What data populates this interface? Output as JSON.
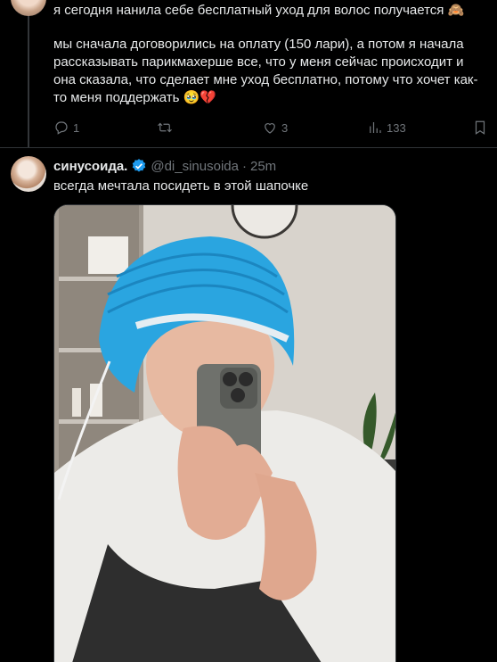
{
  "tweet1": {
    "line1": "я сегодня нанила себе бесплатный уход для волос получается 🙈",
    "body": "мы сначала договорились на оплату (150 лари), а потом я начала рассказывать парикмахерше все, что у меня сейчас происходит и она сказала, что сделает мне уход бесплатно, потому что хочет как-то меня поддержать 🥹💔",
    "replies": "1",
    "likes": "3",
    "views": "133"
  },
  "tweet2": {
    "name": "синусоида.",
    "handle": "@di_sinusoida",
    "dot": "·",
    "time": "25m",
    "text": "всегда мечтала посидеть в этой шапочке"
  },
  "colors": {
    "background": "#000000",
    "text": "#e7e9ea",
    "muted": "#71767b",
    "verified": "#1d9bf0",
    "cap": "#2aa5e0"
  },
  "icons": [
    "reply-icon",
    "retweet-icon",
    "like-icon",
    "views-icon",
    "bookmark-icon",
    "verified-badge-icon"
  ]
}
